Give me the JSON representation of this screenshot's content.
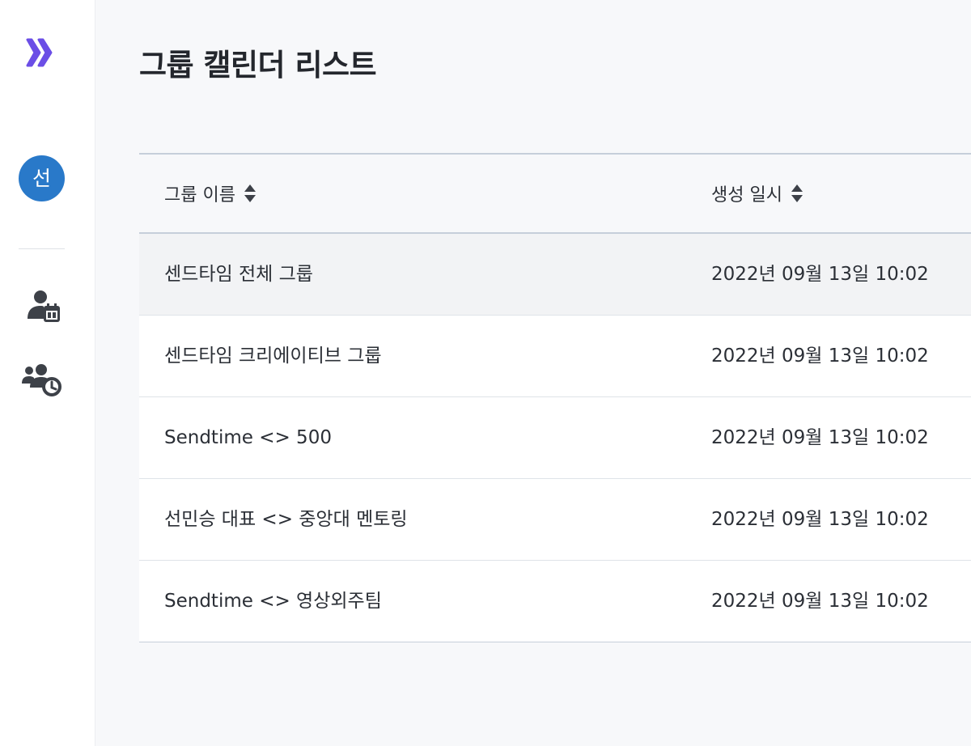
{
  "sidebar": {
    "avatar_initial": "선",
    "nav_items": [
      {
        "icon": "user-calendar-icon"
      },
      {
        "icon": "group-clock-icon"
      }
    ]
  },
  "page": {
    "title": "그룹 캘린더 리스트"
  },
  "table": {
    "columns": [
      {
        "label": "그룹 이름",
        "sortable": true
      },
      {
        "label": "생성 일시",
        "sortable": true
      }
    ],
    "rows": [
      {
        "name": "센드타임 전체 그룹",
        "created": "2022년 09월 13일 10:02"
      },
      {
        "name": "센드타임 크리에이티브 그룹",
        "created": "2022년 09월 13일 10:02"
      },
      {
        "name": "Sendtime <> 500",
        "created": "2022년 09월 13일 10:02"
      },
      {
        "name": "선민승 대표 <> 중앙대 멘토링",
        "created": "2022년 09월 13일 10:02"
      },
      {
        "name": "Sendtime <> 영상외주팀",
        "created": "2022년 09월 13일 10:02"
      }
    ]
  },
  "colors": {
    "brand": "#6b4ee6",
    "avatar": "#2979c9",
    "icon": "#3d4148"
  }
}
